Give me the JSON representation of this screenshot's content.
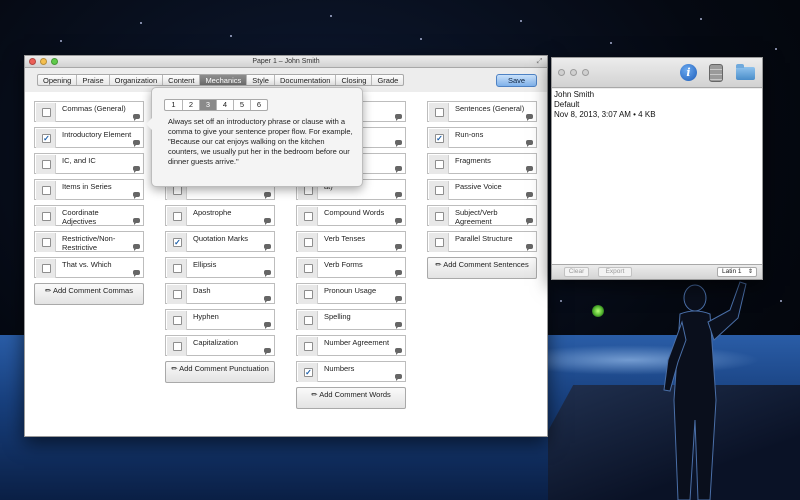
{
  "main_window": {
    "title": "Paper 1 – John Smith",
    "tabs": [
      {
        "label": "Opening",
        "active": false
      },
      {
        "label": "Praise",
        "active": false
      },
      {
        "label": "Organization",
        "active": false
      },
      {
        "label": "Content",
        "active": false
      },
      {
        "label": "Mechanics",
        "active": true
      },
      {
        "label": "Style",
        "active": false
      },
      {
        "label": "Documentation",
        "active": false
      },
      {
        "label": "Closing",
        "active": false
      },
      {
        "label": "Grade",
        "active": false
      }
    ],
    "save_label": "Save"
  },
  "columns": {
    "commas": {
      "items": [
        {
          "label": "Commas (General)",
          "checked": false
        },
        {
          "label": "Introductory Element",
          "checked": true
        },
        {
          "label": "IC, and IC",
          "checked": false
        },
        {
          "label": "Items in Series",
          "checked": false
        },
        {
          "label": "Coordinate Adjectives",
          "checked": false
        },
        {
          "label": "Restrictive/Non-Restrictive",
          "checked": false
        },
        {
          "label": "That vs. Which",
          "checked": false
        }
      ],
      "add_label": "✏ Add Comment Commas"
    },
    "punctuation": {
      "items": [
        {
          "label": "",
          "checked": false
        },
        {
          "label": "",
          "checked": false
        },
        {
          "label": "",
          "checked": false
        },
        {
          "label": "",
          "checked": false
        },
        {
          "label": "Apostrophe",
          "checked": false
        },
        {
          "label": "Quotation Marks",
          "checked": true
        },
        {
          "label": "Ellipsis",
          "checked": false
        },
        {
          "label": "Dash",
          "checked": false
        },
        {
          "label": "Hyphen",
          "checked": false
        },
        {
          "label": "Capitalization",
          "checked": false
        }
      ],
      "add_label": "✏ Add Comment Punctuation"
    },
    "words": {
      "items": [
        {
          "label": "",
          "checked": false
        },
        {
          "label": "s",
          "checked": false
        },
        {
          "label": "d",
          "checked": false
        },
        {
          "label": "at)",
          "checked": false
        },
        {
          "label": "Compound Words",
          "checked": false
        },
        {
          "label": "Verb Tenses",
          "checked": false
        },
        {
          "label": "Verb Forms",
          "checked": false
        },
        {
          "label": "Pronoun Usage",
          "checked": false
        },
        {
          "label": "Spelling",
          "checked": false
        },
        {
          "label": "Number Agreement",
          "checked": false
        },
        {
          "label": "Numbers",
          "checked": true
        }
      ],
      "add_label": "✏ Add Comment Words"
    },
    "sentences": {
      "items": [
        {
          "label": "Sentences (General)",
          "checked": false
        },
        {
          "label": "Run-ons",
          "checked": true
        },
        {
          "label": "Fragments",
          "checked": false
        },
        {
          "label": "Passive Voice",
          "checked": false
        },
        {
          "label": "Subject/Verb Agreement",
          "checked": false
        },
        {
          "label": "Parallel Structure",
          "checked": false
        }
      ],
      "add_label": "✏ Add Comment Sentences"
    }
  },
  "popover": {
    "pages": [
      "1",
      "2",
      "3",
      "4",
      "5",
      "6"
    ],
    "active_page": "3",
    "text": "Always set off an introductory phrase or clause with a comma to give your sentence proper flow. For example, \"Because our cat enjoys walking on the kitchen counters, we usually put her in the bedroom before our dinner guests arrive.\""
  },
  "side_window": {
    "toolbar_icons": [
      "info-icon",
      "database-icon",
      "folder-icon"
    ],
    "name": "John Smith",
    "template": "Default",
    "meta": "Nov 8, 2013, 3:07 AM • 4 KB",
    "clear_label": "Clear",
    "export_label": "Export",
    "encoding_value": "Latin 1"
  },
  "colors": {
    "accent": "#1d5fa8",
    "save_button": "#7fb1ea",
    "active_tab": "#7a7a7a"
  }
}
